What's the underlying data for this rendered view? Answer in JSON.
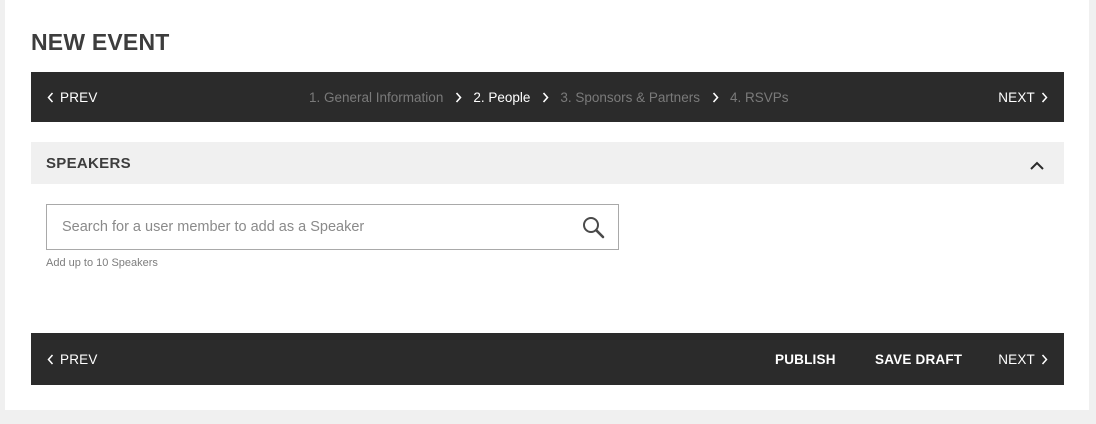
{
  "page": {
    "title": "NEW EVENT"
  },
  "wizard": {
    "prev_label": "PREV",
    "next_label": "NEXT",
    "steps": [
      {
        "label": "1. General Information",
        "active": false
      },
      {
        "label": "2. People",
        "active": true
      },
      {
        "label": "3. Sponsors & Partners",
        "active": false
      },
      {
        "label": "4. RSVPs",
        "active": false
      }
    ]
  },
  "speakers": {
    "section_title": "SPEAKERS",
    "search_placeholder": "Search for a user member to add as a Speaker",
    "search_value": "",
    "helper": "Add up to 10 Speakers"
  },
  "footer": {
    "prev_label": "PREV",
    "publish_label": "PUBLISH",
    "save_draft_label": "SAVE DRAFT",
    "next_label": "NEXT"
  },
  "icons": {
    "prev": "chevron-left-icon",
    "next": "chevron-right-icon",
    "step_separator": "chevron-right-icon",
    "collapse": "chevron-up-icon",
    "search": "search-icon"
  },
  "colors": {
    "bar_background": "#2b2b2b",
    "section_background": "#f0f0f0",
    "inactive_step": "#7a7a7a",
    "active_step": "#ffffff",
    "title_text": "#3d3d3d"
  }
}
